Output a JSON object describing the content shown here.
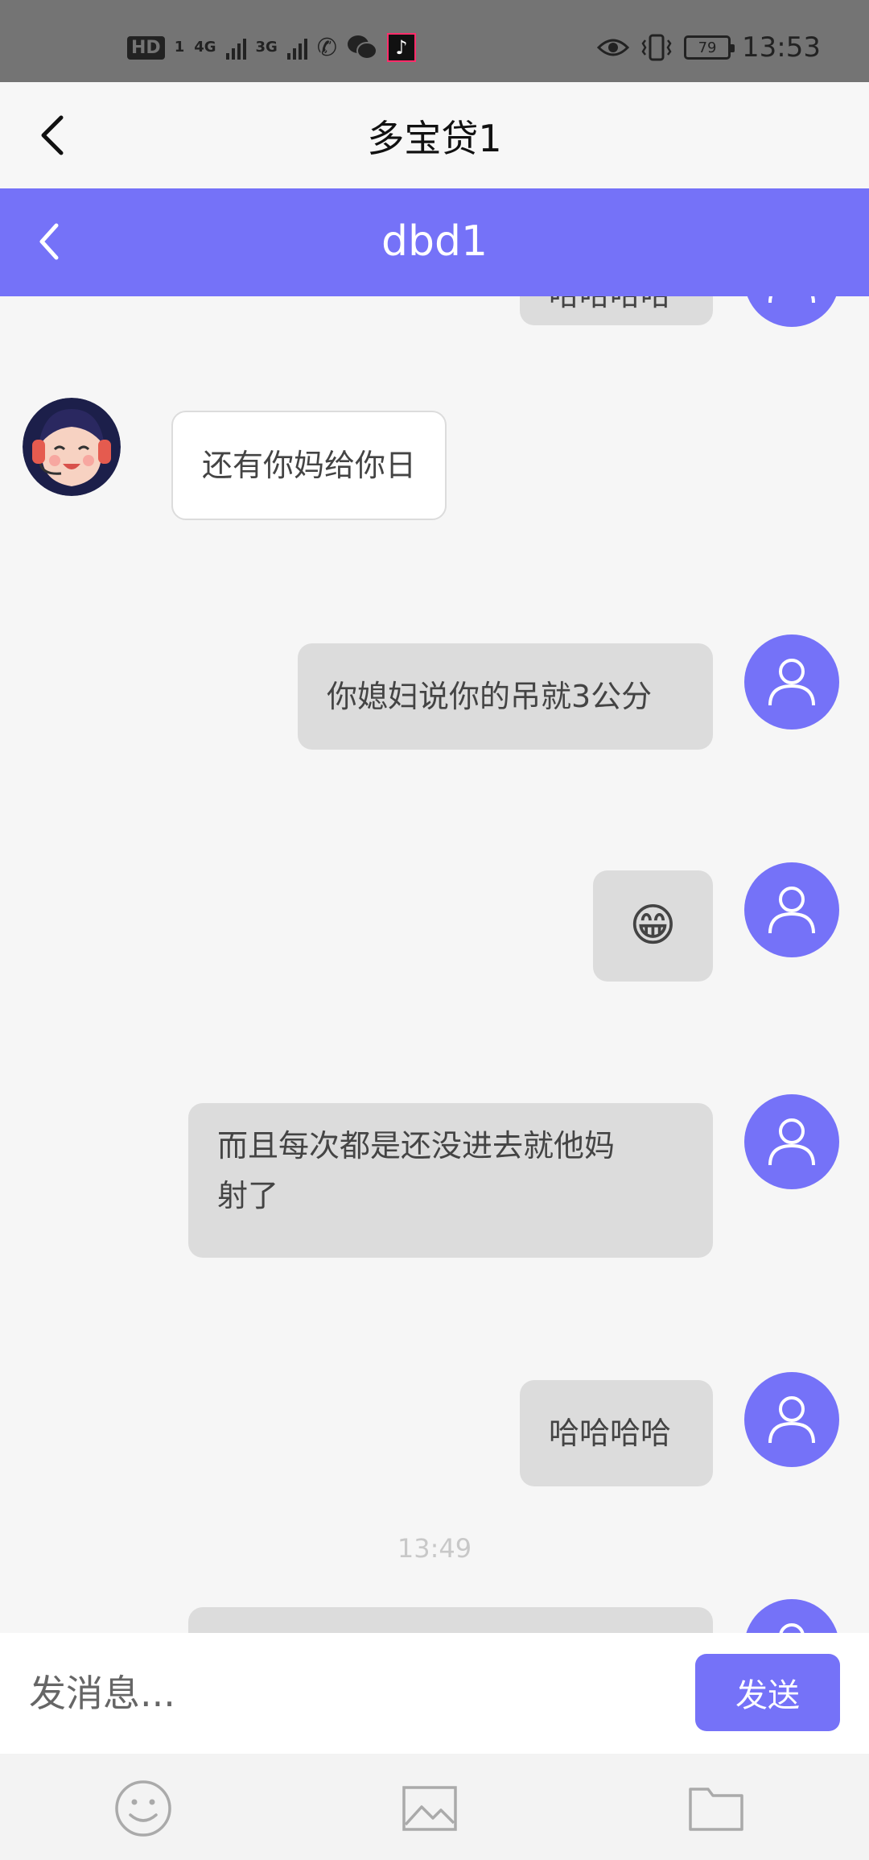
{
  "status_bar": {
    "hd": "HD",
    "sim1": "1",
    "net1": "4G",
    "net2": "3G",
    "battery": "79",
    "time": "13:53"
  },
  "app_bar": {
    "title": "多宝贷1"
  },
  "chat_header": {
    "title": "dbd1"
  },
  "messages": {
    "partial_top": "哈哈哈哈",
    "m1": "还有你妈给你日",
    "m2": "你媳妇说你的吊就3公分",
    "m3": "😁",
    "m4_line1": "而且每次都是还没进去就他妈",
    "m4_line2": "射了",
    "m5": "哈哈哈哈",
    "timestamp": "13:49"
  },
  "input": {
    "placeholder": "发消息...",
    "value": ""
  },
  "send_button": {
    "label": "发送"
  },
  "icons": [
    "smiley-icon",
    "image-icon",
    "folder-icon",
    "user-avatar-icon",
    "back-arrow-icon"
  ],
  "colors": {
    "accent": "#7572f8",
    "bubble_out": "#dcdcdc",
    "bubble_in": "#ffffff"
  }
}
